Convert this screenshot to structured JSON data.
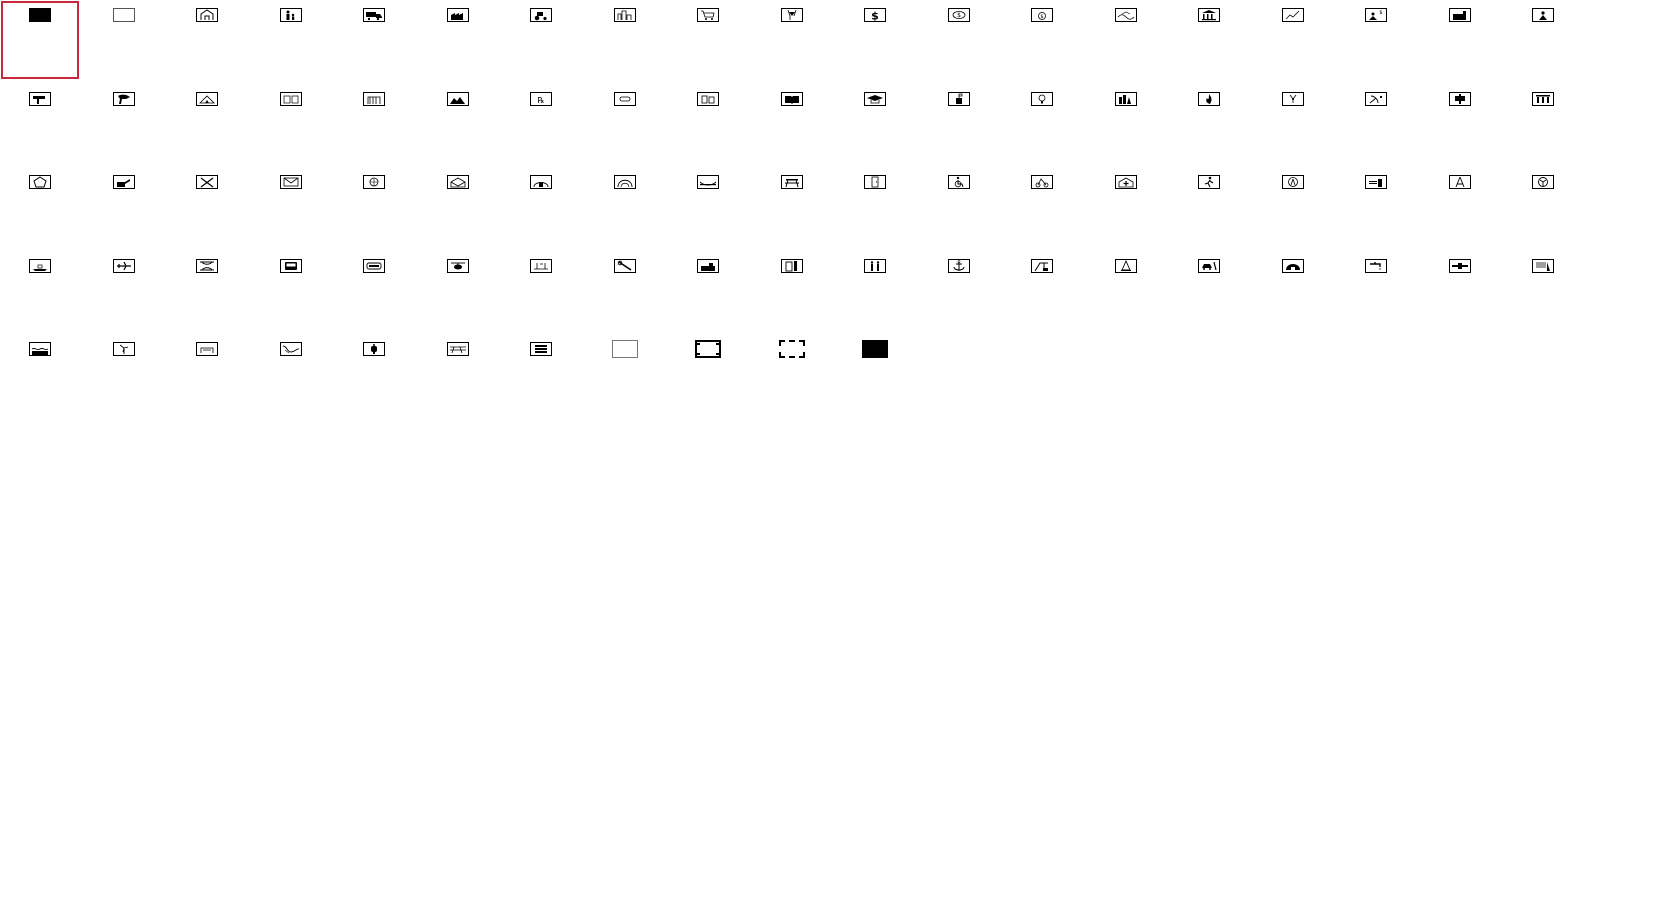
{
  "selected_index": 0,
  "columns": 19,
  "patterns": [
    {
      "name": "solid-fill-icon",
      "kind": "solid"
    },
    {
      "name": "empty-fill-icon",
      "kind": "plain"
    },
    {
      "name": "house-icon",
      "kind": "glyph"
    },
    {
      "name": "family-icon",
      "kind": "glyph"
    },
    {
      "name": "truck-icon",
      "kind": "glyph"
    },
    {
      "name": "factory-icon",
      "kind": "glyph"
    },
    {
      "name": "tractor-icon",
      "kind": "glyph"
    },
    {
      "name": "city-icon",
      "kind": "glyph"
    },
    {
      "name": "shopping-cart-icon",
      "kind": "glyph"
    },
    {
      "name": "drink-icon",
      "kind": "glyph"
    },
    {
      "name": "dollar-icon",
      "kind": "glyph"
    },
    {
      "name": "cash-icon",
      "kind": "glyph"
    },
    {
      "name": "money-bag-icon",
      "kind": "glyph"
    },
    {
      "name": "landscape-icon",
      "kind": "glyph"
    },
    {
      "name": "bank-icon",
      "kind": "glyph"
    },
    {
      "name": "chart-growth-icon",
      "kind": "glyph"
    },
    {
      "name": "investor-icon",
      "kind": "glyph"
    },
    {
      "name": "industry-icon",
      "kind": "glyph"
    },
    {
      "name": "worker-icon",
      "kind": "glyph"
    },
    {
      "name": "drill-icon",
      "kind": "glyph"
    },
    {
      "name": "gas-pump-icon",
      "kind": "glyph"
    },
    {
      "name": "tent-icon",
      "kind": "glyph"
    },
    {
      "name": "storage-icon",
      "kind": "glyph"
    },
    {
      "name": "warehouse-icon",
      "kind": "glyph"
    },
    {
      "name": "farm-icon",
      "kind": "glyph"
    },
    {
      "name": "pharmacy-icon",
      "kind": "glyph"
    },
    {
      "name": "pill-icon",
      "kind": "glyph"
    },
    {
      "name": "containers-icon",
      "kind": "glyph"
    },
    {
      "name": "book-icon",
      "kind": "glyph"
    },
    {
      "name": "graduation-cap-icon",
      "kind": "glyph"
    },
    {
      "name": "school-icon",
      "kind": "glyph"
    },
    {
      "name": "lightbulb-icon",
      "kind": "glyph"
    },
    {
      "name": "power-plant-icon",
      "kind": "glyph"
    },
    {
      "name": "fire-icon",
      "kind": "glyph"
    },
    {
      "name": "radiation-icon",
      "kind": "glyph"
    },
    {
      "name": "satellite-dish-icon",
      "kind": "glyph"
    },
    {
      "name": "bus-stop-icon",
      "kind": "glyph"
    },
    {
      "name": "columns-icon",
      "kind": "glyph"
    },
    {
      "name": "pentagon-icon",
      "kind": "glyph"
    },
    {
      "name": "military-icon",
      "kind": "glyph"
    },
    {
      "name": "crossed-rifles-icon",
      "kind": "glyph"
    },
    {
      "name": "envelope-icon",
      "kind": "glyph"
    },
    {
      "name": "globe-mail-icon",
      "kind": "glyph"
    },
    {
      "name": "open-envelope-icon",
      "kind": "glyph"
    },
    {
      "name": "shelter-icon",
      "kind": "glyph"
    },
    {
      "name": "tunnel-icon",
      "kind": "glyph"
    },
    {
      "name": "bridge-icon",
      "kind": "glyph"
    },
    {
      "name": "picnic-table-icon",
      "kind": "glyph"
    },
    {
      "name": "door-icon",
      "kind": "glyph"
    },
    {
      "name": "wheelchair-icon",
      "kind": "glyph"
    },
    {
      "name": "cyclist-icon",
      "kind": "glyph"
    },
    {
      "name": "hospital-icon",
      "kind": "glyph"
    },
    {
      "name": "hiker-icon",
      "kind": "glyph"
    },
    {
      "name": "antenna-icon",
      "kind": "glyph"
    },
    {
      "name": "press-icon",
      "kind": "glyph"
    },
    {
      "name": "compass-icon",
      "kind": "glyph"
    },
    {
      "name": "wheel-icon",
      "kind": "glyph"
    },
    {
      "name": "ship-icon",
      "kind": "glyph"
    },
    {
      "name": "airplane-icon",
      "kind": "glyph"
    },
    {
      "name": "bridge-arch-icon",
      "kind": "glyph"
    },
    {
      "name": "bus-icon",
      "kind": "glyph"
    },
    {
      "name": "train-icon",
      "kind": "glyph"
    },
    {
      "name": "helicopter-icon",
      "kind": "glyph"
    },
    {
      "name": "runway-icon",
      "kind": "glyph"
    },
    {
      "name": "wrench-icon",
      "kind": "glyph"
    },
    {
      "name": "cargo-icon",
      "kind": "glyph"
    },
    {
      "name": "fuel-station-icon",
      "kind": "glyph"
    },
    {
      "name": "restroom-icon",
      "kind": "glyph"
    },
    {
      "name": "anchor-icon",
      "kind": "glyph"
    },
    {
      "name": "crane-icon",
      "kind": "glyph"
    },
    {
      "name": "cone-icon",
      "kind": "glyph"
    },
    {
      "name": "car-repair-icon",
      "kind": "glyph"
    },
    {
      "name": "dome-icon",
      "kind": "glyph"
    },
    {
      "name": "faucet-icon",
      "kind": "glyph"
    },
    {
      "name": "pipeline-icon",
      "kind": "glyph"
    },
    {
      "name": "dam-icon",
      "kind": "glyph"
    },
    {
      "name": "water-icon",
      "kind": "glyph"
    },
    {
      "name": "wind-turbine-icon",
      "kind": "glyph"
    },
    {
      "name": "shed-icon",
      "kind": "glyph"
    },
    {
      "name": "river-icon",
      "kind": "glyph"
    },
    {
      "name": "lantern-icon",
      "kind": "glyph"
    },
    {
      "name": "railway-icon",
      "kind": "glyph"
    },
    {
      "name": "server-icon",
      "kind": "glyph"
    },
    {
      "name": "outline-box-icon",
      "kind": "outline"
    },
    {
      "name": "thick-bracket-box-icon",
      "kind": "bracket"
    },
    {
      "name": "dashed-box-icon",
      "kind": "dashed"
    },
    {
      "name": "solid-box-icon",
      "kind": "solidwide"
    }
  ]
}
